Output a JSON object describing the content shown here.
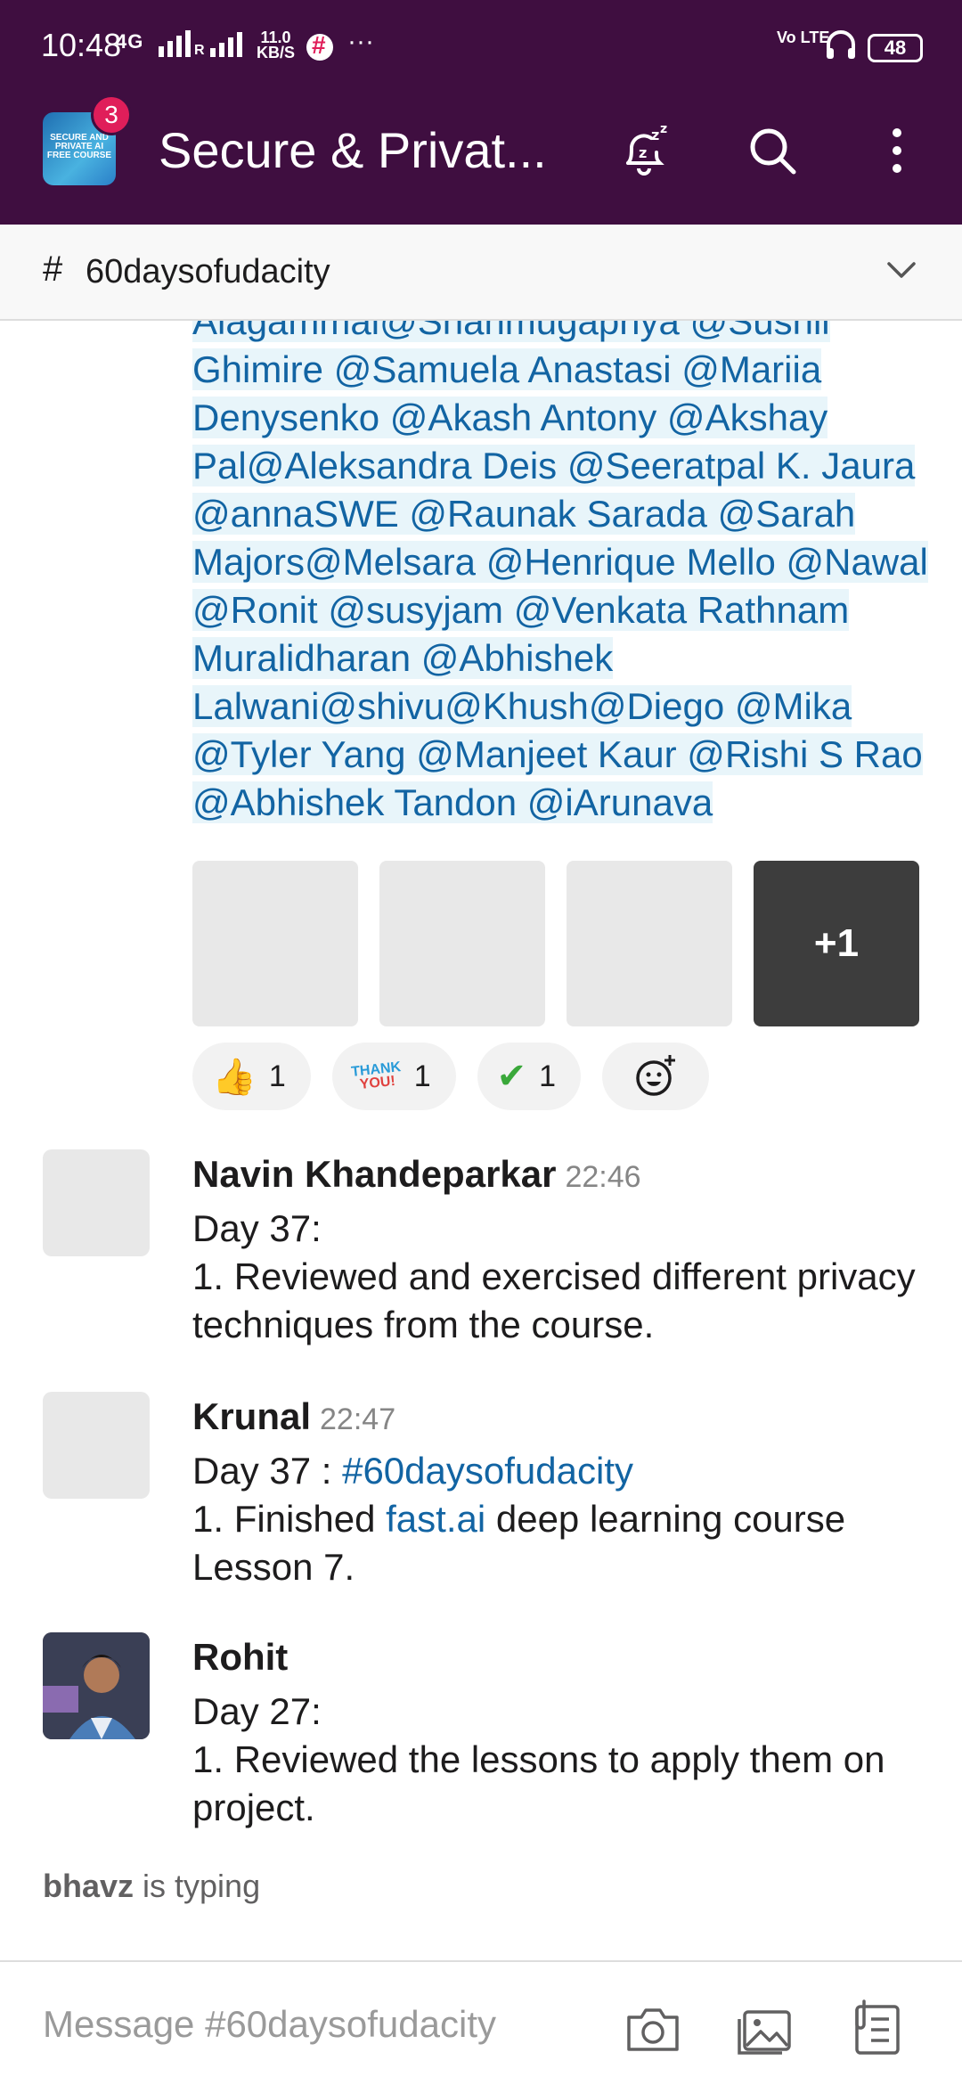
{
  "status_bar": {
    "time": "10:48",
    "network": "4G",
    "roaming": "R",
    "speed_value": "11.0",
    "speed_unit": "KB/S",
    "more": "···",
    "volte": "Vo LTE",
    "battery": "48"
  },
  "app_bar": {
    "workspace_icon_text": "SECURE AND PRIVATE AI FREE COURSE",
    "badge_count": "3",
    "title": "Secure & Privat...",
    "icons": [
      "snooze-bell-icon",
      "search-icon",
      "more-vert-icon"
    ]
  },
  "channel": {
    "hash": "#",
    "name": "60daysofudacity"
  },
  "mention_block": {
    "text": "Alagammai@Shanmugapriya @Sushil Ghimire @Samuela Anastasi @Mariia Denysenko @Akash Antony @Akshay Pal@Aleksandra Deis @Seeratpal K. Jaura @annaSWE @Raunak Sarada @Sarah Majors@Melsara @Henrique Mello @Nawal @Ronit @susyjam @Venkata Rathnam Muralidharan @Abhishek Lalwani@shivu@Khush@Diego @Mika @Tyler Yang @Manjeet Kaur @Rishi S Rao @Abhishek Tandon @iArunava"
  },
  "attachments": {
    "more_label": "+1"
  },
  "reactions": [
    {
      "emoji": "👍",
      "count": "1"
    },
    {
      "emoji_text_1": "THANK",
      "emoji_text_2": "YOU!",
      "count": "1"
    },
    {
      "emoji": "✔",
      "count": "1"
    }
  ],
  "messages": [
    {
      "author": "Navin Khandeparkar",
      "time": "22:46",
      "line1": "Day 37:",
      "line2": "1. Reviewed and exercised different privacy techniques from the course."
    },
    {
      "author": "Krunal",
      "time": "22:47",
      "line1_prefix": "Day 37 : ",
      "line1_link": "#60daysofudacity",
      "line2_prefix": "1. Finished ",
      "line2_link": "fast.ai",
      "line2_suffix": " deep learning course Lesson 7."
    },
    {
      "author": "Rohit",
      "time": "",
      "line1": "Day 27:",
      "line2": "1. Reviewed the lessons to apply them on project."
    }
  ],
  "typing": {
    "user": "bhavz",
    "suffix": " is typing"
  },
  "composer": {
    "placeholder": "Message #60daysofudacity"
  }
}
